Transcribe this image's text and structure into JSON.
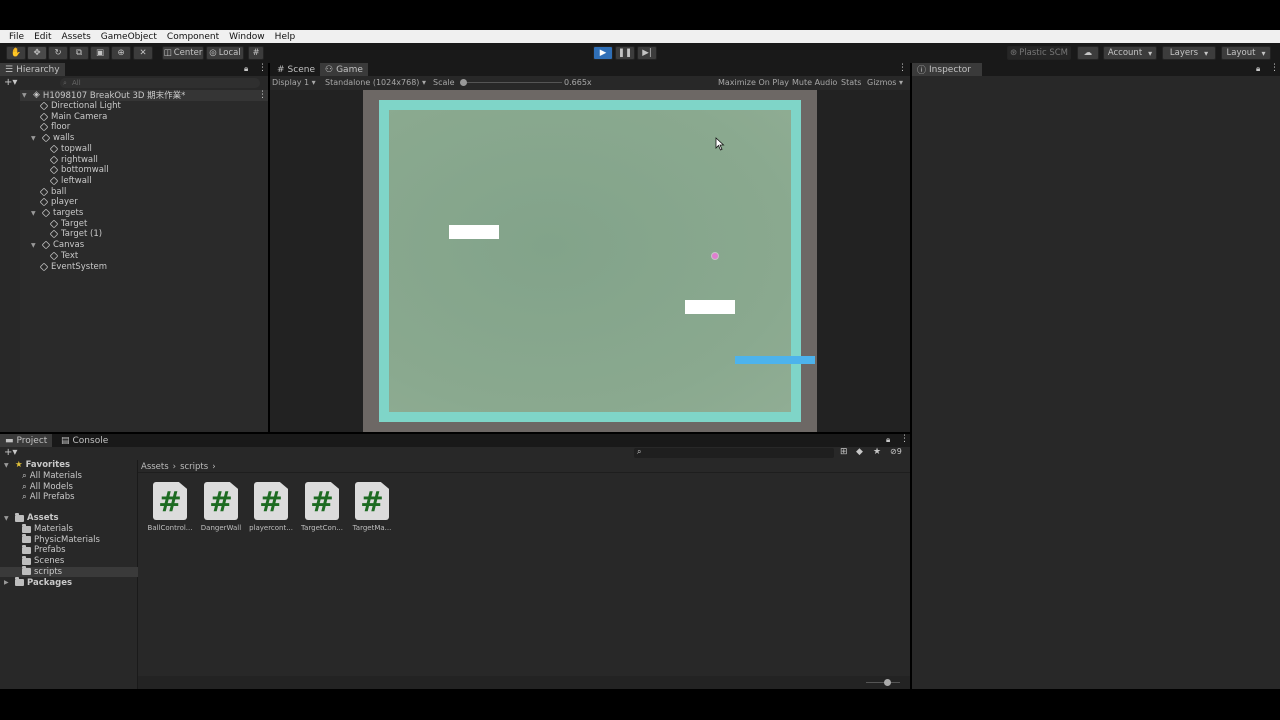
{
  "menu": [
    "File",
    "Edit",
    "Assets",
    "GameObject",
    "Component",
    "Window",
    "Help"
  ],
  "toolbar": {
    "pivot": "Center",
    "space": "Local",
    "plastic": "Plastic SCM",
    "account": "Account",
    "layers": "Layers",
    "layout": "Layout"
  },
  "hierarchy": {
    "title": "Hierarchy",
    "search_placeholder": "All",
    "scene": "H1098107 BreakOut 3D 期末作業*",
    "items": [
      "Directional Light",
      "Main Camera",
      "floor",
      "walls",
      "topwall",
      "rightwall",
      "bottomwall",
      "leftwall",
      "ball",
      "player",
      "targets",
      "Target",
      "Target (1)",
      "Canvas",
      "Text",
      "EventSystem"
    ]
  },
  "viewtabs": {
    "scene": "Scene",
    "game": "Game"
  },
  "game_toolbar": {
    "display": "Display 1",
    "resolution": "Standalone (1024x768)",
    "scale_label": "Scale",
    "scale_value": "0.665x",
    "maximize": "Maximize On Play",
    "mute": "Mute Audio",
    "stats": "Stats",
    "gizmos": "Gizmos"
  },
  "inspector": {
    "title": "Inspector"
  },
  "project": {
    "tab_project": "Project",
    "tab_console": "Console",
    "favorites": "Favorites",
    "fav_items": [
      "All Materials",
      "All Models",
      "All Prefabs"
    ],
    "assets": "Assets",
    "asset_folders": [
      "Materials",
      "PhysicMaterials",
      "Prefabs",
      "Scenes",
      "scripts"
    ],
    "packages": "Packages",
    "breadcrumb": [
      "Assets",
      "scripts"
    ],
    "hidden_count": "9",
    "scripts": [
      "BallControl...",
      "DangerWall",
      "playercont...",
      "TargetCon...",
      "TargetMa..."
    ]
  },
  "colors": {
    "game_bg": "#88a58c",
    "wall": "#7fd5c8",
    "play": "#2f6fb7",
    "paddle": "#4db3ec",
    "ball": "#e07fd0"
  }
}
